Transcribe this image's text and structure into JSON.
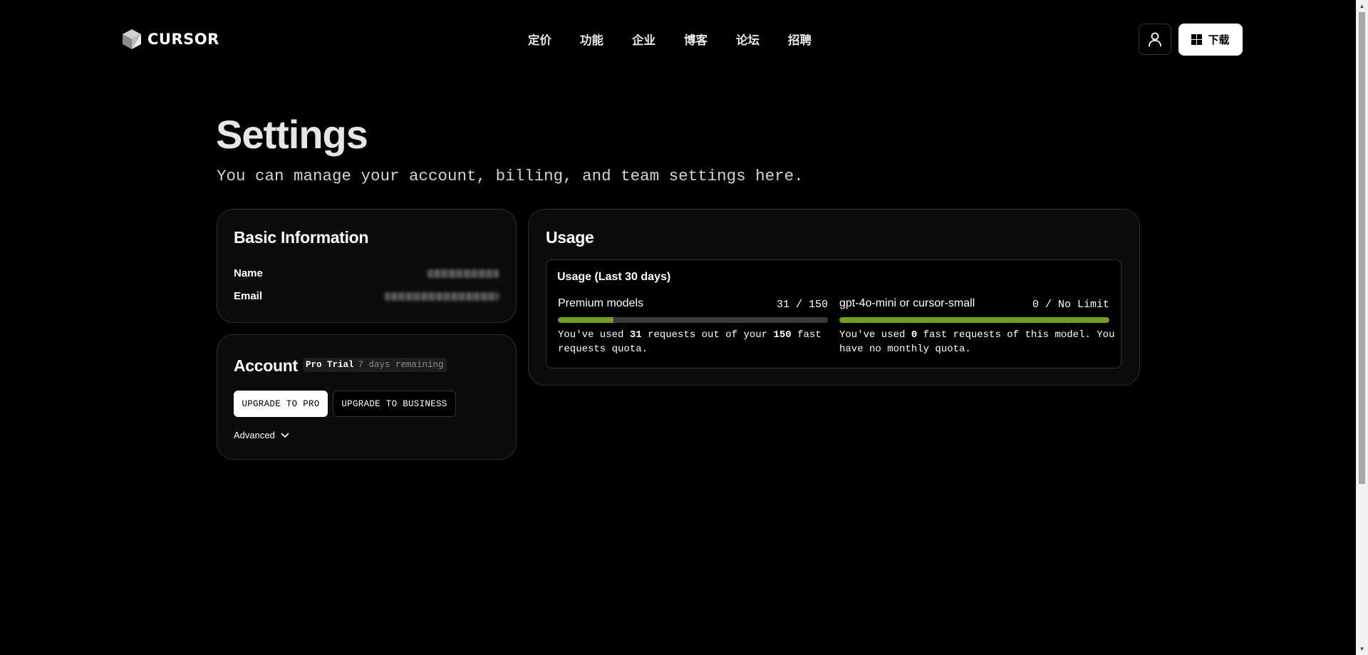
{
  "header": {
    "brand": "CURSOR",
    "nav": [
      "定价",
      "功能",
      "企业",
      "博客",
      "论坛",
      "招聘"
    ],
    "download_label": "下载",
    "icons": {
      "account": "user-icon",
      "download": "windows-icon"
    }
  },
  "page": {
    "title": "Settings",
    "subtitle": "You can manage your account, billing, and team settings here."
  },
  "basic_info": {
    "title": "Basic Information",
    "name_label": "Name",
    "email_label": "Email"
  },
  "account": {
    "title": "Account",
    "plan": "Pro Trial",
    "remaining": "7 days remaining",
    "upgrade_pro": "UPGRADE TO PRO",
    "upgrade_business": "UPGRADE TO BUSINESS",
    "advanced": "Advanced"
  },
  "usage": {
    "title": "Usage",
    "period_title": "Usage (Last 30 days)",
    "premium": {
      "name": "Premium models",
      "count": "31 / 150",
      "used": 31,
      "limit": 150,
      "progress": 0.2067,
      "desc_pre": "You've used ",
      "desc_used": "31",
      "desc_mid": " requests out of your ",
      "desc_limit": "150",
      "desc_post": " fast requests quota."
    },
    "small": {
      "name": "gpt-4o-mini or cursor-small",
      "count": "0 / No Limit",
      "progress": 1.0,
      "desc_pre": "You've used ",
      "desc_used": "0",
      "desc_post": " fast requests of this model. You have no monthly quota."
    }
  },
  "colors": {
    "background": "#000000",
    "progress_fill": "#6ea319",
    "progress_track": "#3a3a3a",
    "card_border": "#2e2e2e"
  }
}
